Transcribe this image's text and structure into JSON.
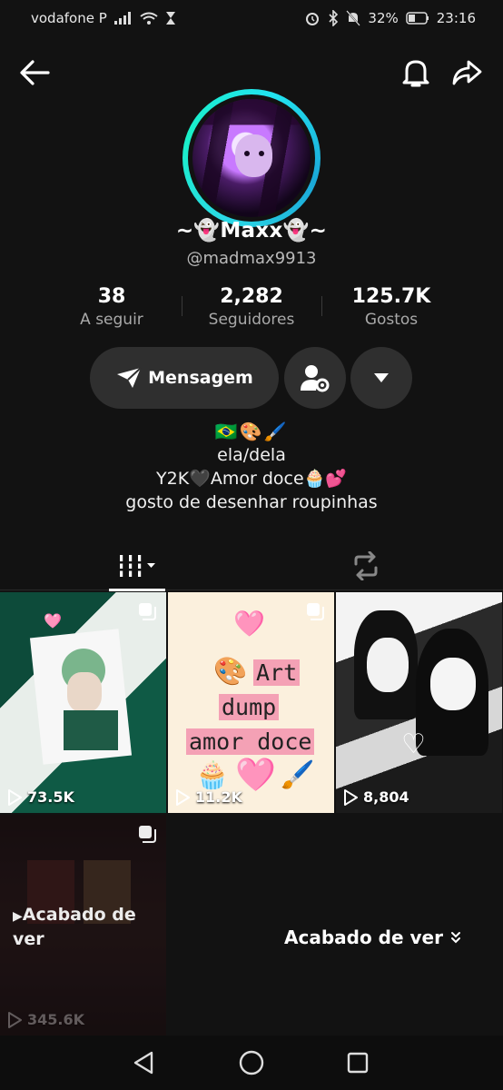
{
  "status_bar": {
    "carrier": "vodafone P",
    "battery": "32%",
    "time": "23:16"
  },
  "profile": {
    "display_name": "~👻Maxx👻~",
    "username": "@madmax9913"
  },
  "stats": [
    {
      "value": "38",
      "label": "A seguir"
    },
    {
      "value": "2,282",
      "label": "Seguidores"
    },
    {
      "value": "125.7K",
      "label": "Gostos"
    }
  ],
  "actions": {
    "message_label": "Mensagem"
  },
  "bio": {
    "emojis": "🇧🇷🎨🖌️",
    "line1": "ela/dela",
    "line2": "Y2K🖤Amor doce🧁💕",
    "line3": "gosto de desenhar roupinhas"
  },
  "videos": [
    {
      "views": "73.5K"
    },
    {
      "views": "11.2K",
      "art_line1": "Art",
      "art_line2": "dump",
      "art_line3": "amor doce"
    },
    {
      "views": "8,804"
    },
    {
      "views": "345.6K",
      "seen_label": "Acabado de ver"
    }
  ],
  "recently_watched": {
    "label": "Acabado de ver"
  }
}
